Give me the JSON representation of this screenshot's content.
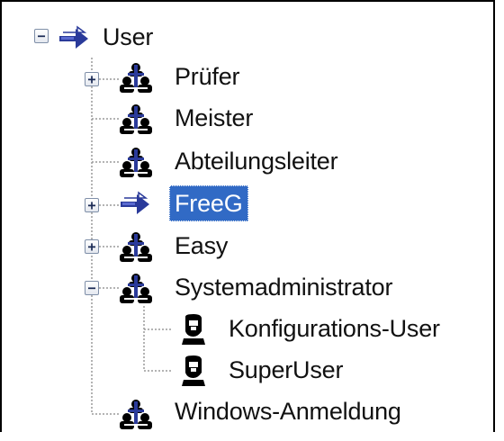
{
  "tree": {
    "root": {
      "label": "User",
      "icon": "arrow-user-group-icon",
      "expanded": true
    },
    "items": [
      {
        "label": "Prüfer",
        "icon": "user-group-icon",
        "expander": "plus"
      },
      {
        "label": "Meister",
        "icon": "user-group-icon",
        "expander": "none"
      },
      {
        "label": "Abteilungsleiter",
        "icon": "user-group-icon",
        "expander": "none"
      },
      {
        "label": "FreeG",
        "icon": "arrow-user-group-icon",
        "expander": "plus",
        "selected": true
      },
      {
        "label": "Easy",
        "icon": "user-group-icon",
        "expander": "plus"
      },
      {
        "label": "Systemadministrator",
        "icon": "user-group-icon",
        "expander": "minus",
        "children": [
          {
            "label": "Konfigurations-User",
            "icon": "single-user-icon"
          },
          {
            "label": "SuperUser",
            "icon": "single-user-icon"
          }
        ]
      },
      {
        "label": "Windows-Anmeldung",
        "icon": "user-group-icon",
        "expander": "none"
      }
    ],
    "expander_glyphs": {
      "plus": "+",
      "minus": "−"
    },
    "colors": {
      "selection": "#316ac5",
      "tree_lines": "#8a8a8a",
      "arrow_blue": "#2a3a9a"
    }
  }
}
